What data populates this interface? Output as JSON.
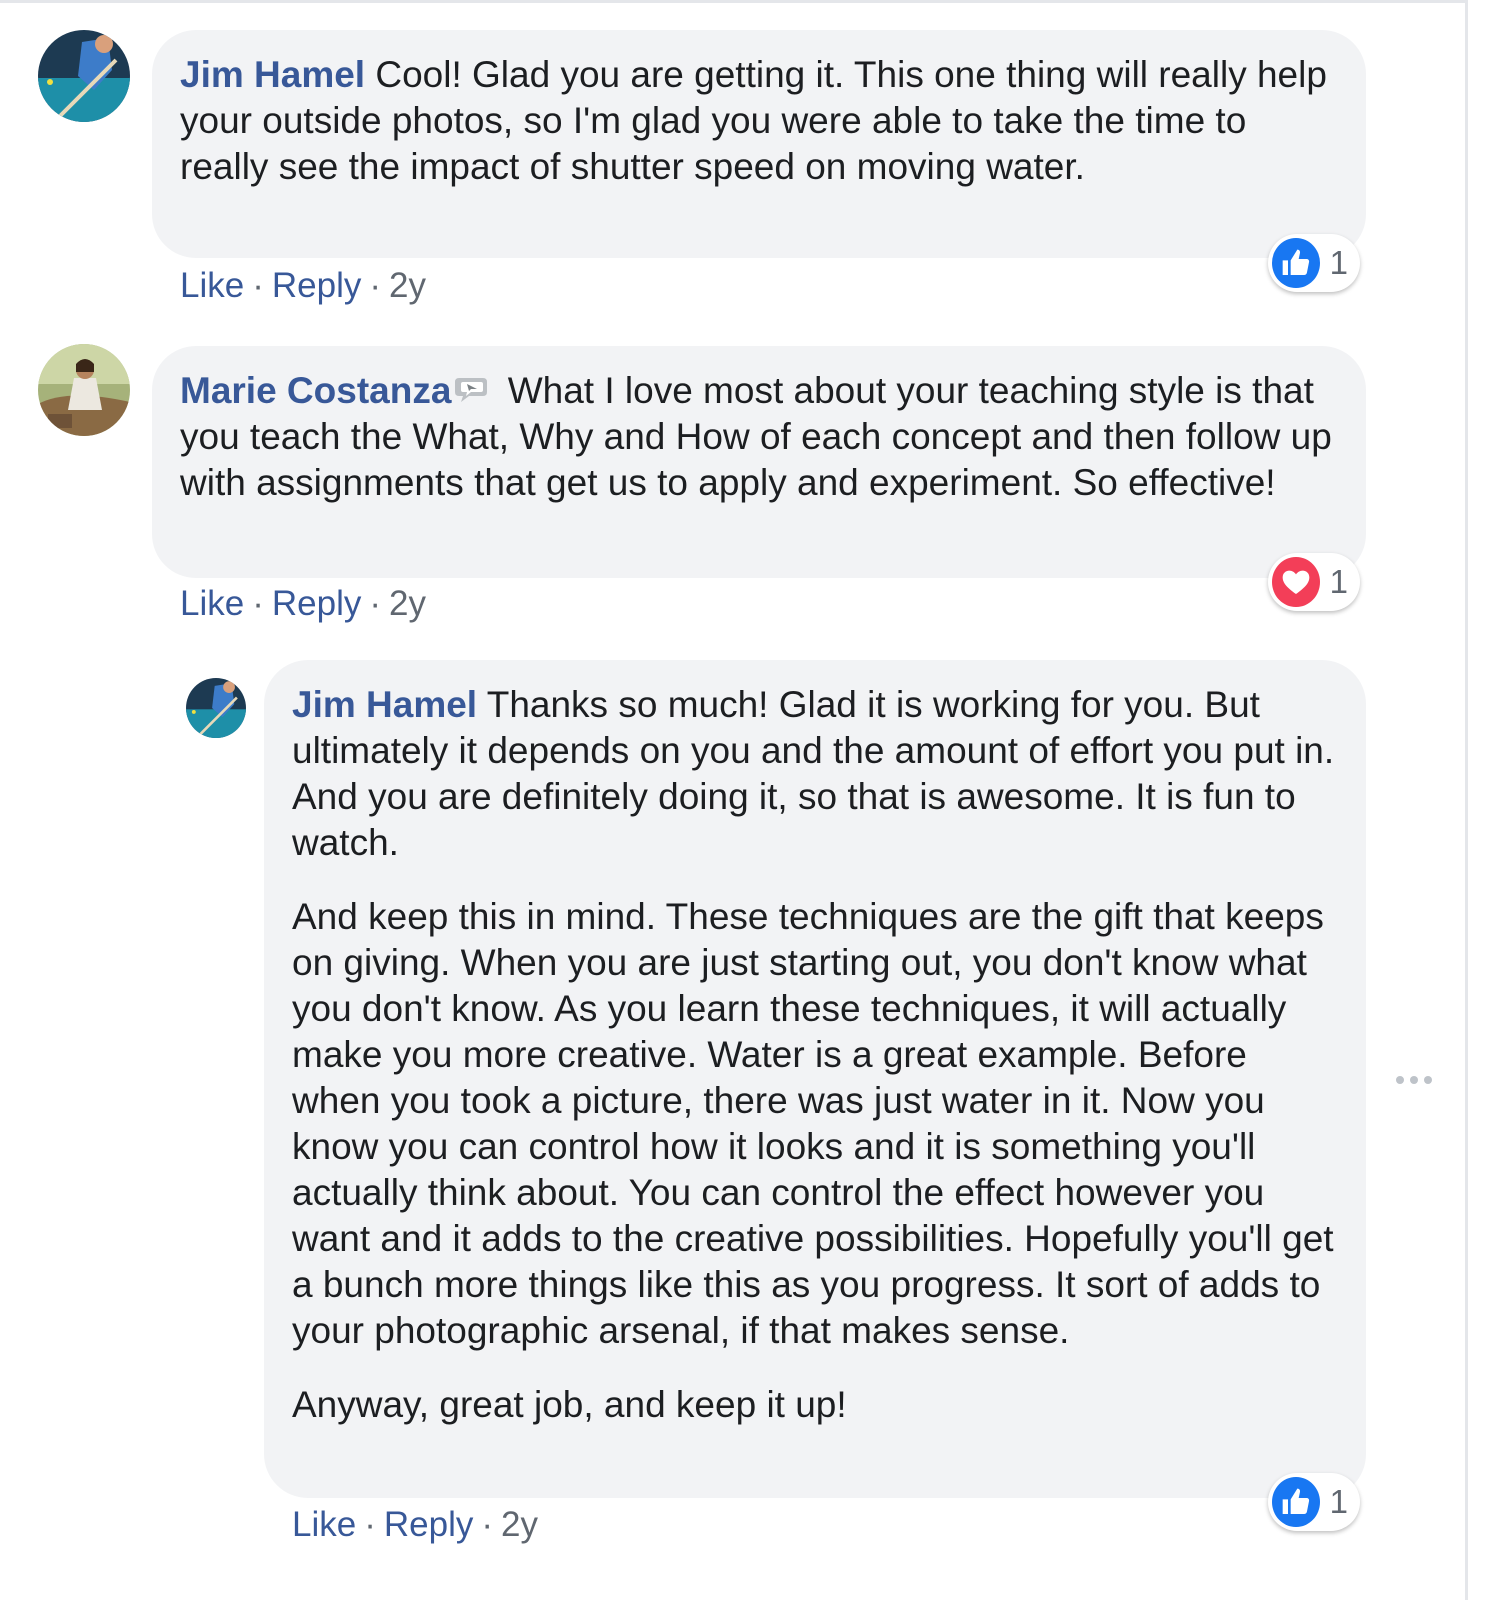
{
  "colors": {
    "author_link": "#385898",
    "bubble_bg": "#f2f3f5",
    "like_blue": "#1877f2",
    "love_red": "#f33e58",
    "meta_gray": "#606770"
  },
  "comments": [
    {
      "author": "Jim Hamel",
      "text": "Cool! Glad you are getting it. This one thing will really help your outside photos, so I'm glad you were able to take the time to really see the impact of shutter speed on moving water.",
      "actions": {
        "like": "Like",
        "reply": "Reply",
        "time": "2y"
      },
      "reaction": {
        "icon": "like-icon",
        "count": "1"
      }
    },
    {
      "author": "Marie Costanza",
      "author_badge_icon": "message-bubble-icon",
      "text": "What I love most about your teaching style is that you teach the What, Why and How of each concept and then follow up with assignments that get us to apply and experiment. So effective!",
      "actions": {
        "like": "Like",
        "reply": "Reply",
        "time": "2y"
      },
      "reaction": {
        "icon": "love-icon",
        "count": "1"
      }
    }
  ],
  "reply": {
    "author": "Jim Hamel",
    "paragraphs": [
      "Thanks so much! Glad it is working for you. But ultimately it depends on you and the amount of effort you put in. And you are definitely doing it, so that is awesome. It is fun to watch.",
      "And keep this in mind. These techniques are the gift that keeps on giving. When you are just starting out, you don't know what you don't know. As you learn these techniques, it will actually make you more creative. Water is a great example. Before when you took a picture, there was just water in it. Now you know you can control how it looks and it is something you'll actually think about. You can control the effect however you want and it adds to the creative possibilities. Hopefully you'll get a bunch more things like this as you progress. It sort of adds to your photographic arsenal, if that makes sense.",
      "Anyway, great job, and keep it up!"
    ],
    "actions": {
      "like": "Like",
      "reply": "Reply",
      "time": "2y"
    },
    "reaction": {
      "icon": "like-icon",
      "count": "1"
    },
    "more_icon": "more-options-icon"
  },
  "separator": "·"
}
